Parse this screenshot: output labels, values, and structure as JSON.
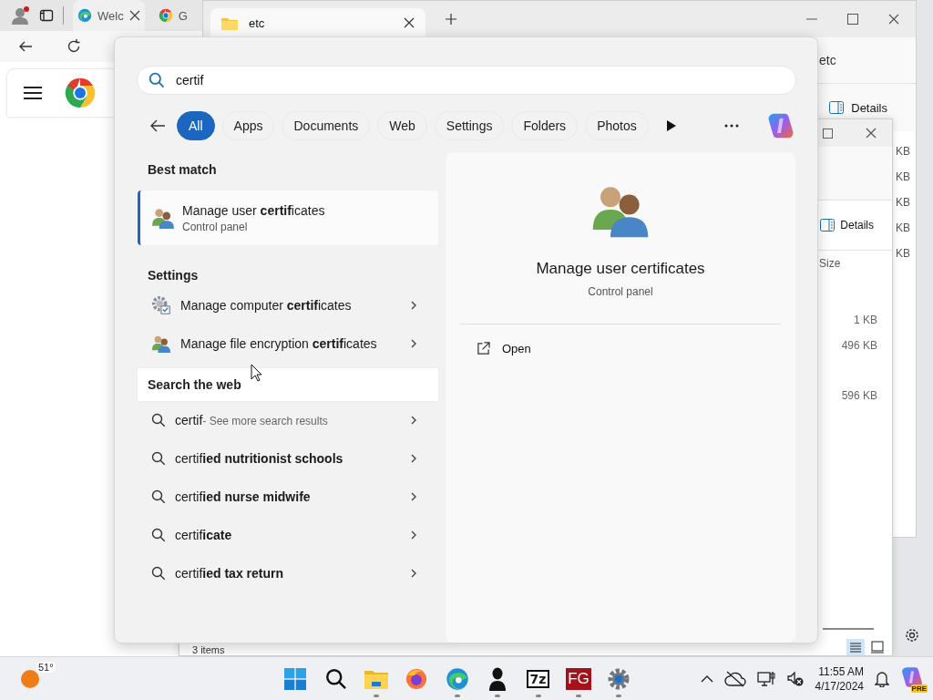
{
  "browser": {
    "tabs": [
      {
        "label": "Welc",
        "kind": "edge",
        "selected": true
      },
      {
        "label": "G",
        "kind": "chrome",
        "selected": false
      }
    ]
  },
  "explorer_back": {
    "tab": "etc",
    "address": "etc",
    "details_button": "Details",
    "size_column": [
      "KB",
      "KB",
      "KB",
      "KB",
      "KB"
    ]
  },
  "explorer_front": {
    "details_button": "Details",
    "size_header": "Size",
    "sizes": [
      "1 KB",
      "496 KB",
      "596 KB"
    ],
    "status": "3 items"
  },
  "search": {
    "query": "certif",
    "filters": [
      {
        "label": "All",
        "selected": true
      },
      {
        "label": "Apps",
        "selected": false
      },
      {
        "label": "Documents",
        "selected": false
      },
      {
        "label": "Web",
        "selected": false
      },
      {
        "label": "Settings",
        "selected": false
      },
      {
        "label": "Folders",
        "selected": false
      },
      {
        "label": "Photos",
        "selected": false
      }
    ],
    "best_match": {
      "heading": "Best match",
      "title": "Manage user **certif**icates",
      "subtitle": "Control panel",
      "selected": true
    },
    "settings": {
      "heading": "Settings",
      "items": [
        {
          "title": "Manage computer **certif**icates",
          "kind": "computer"
        },
        {
          "title": "Manage file encryption **certif**icates",
          "kind": "encryption"
        }
      ]
    },
    "web": {
      "heading": "Search the web",
      "hovered": true,
      "items": [
        {
          "query": "certif",
          "hint": "- See more search results"
        },
        {
          "query": "certif**ied nutritionist schools**"
        },
        {
          "query": "certif**ied nurse midwife**"
        },
        {
          "query": "certif**icate**"
        },
        {
          "query": "certif**ied tax return**"
        }
      ]
    },
    "preview": {
      "title": "Manage user certificates",
      "subtitle": "Control panel",
      "actions": [
        {
          "label": "Open"
        }
      ]
    }
  },
  "taskbar": {
    "weather": "51°",
    "apps": [
      {
        "kind": "start",
        "running": false
      },
      {
        "kind": "search",
        "running": false
      },
      {
        "kind": "folder",
        "running": true
      },
      {
        "kind": "firefox",
        "running": false
      },
      {
        "kind": "edge",
        "running": true
      },
      {
        "kind": "person",
        "running": true
      },
      {
        "kind": "archiver",
        "glyph": "7z",
        "running": true
      },
      {
        "kind": "fg",
        "glyph": "FG",
        "running": true
      },
      {
        "kind": "settings",
        "running": true
      }
    ],
    "time": "11:55 AM",
    "date": "4/17/2024",
    "copilot_badge": "PRE"
  }
}
